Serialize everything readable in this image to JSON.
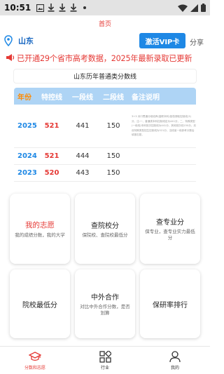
{
  "statusbar": {
    "time": "10:51"
  },
  "header": {
    "title": "首页"
  },
  "location": {
    "province": "山东",
    "vip_label": "激活VIP卡",
    "share_label": "分享"
  },
  "notice": {
    "text": "已开通29个省市高考数据，2025年最新录取已更新"
  },
  "score_table": {
    "title": "山东历年普通类分数线",
    "headers": [
      "年份",
      "特控线",
      "一段线",
      "二段线",
      "备注说明"
    ],
    "rows": [
      {
        "year": "2025",
        "special": "521",
        "tier1": "441",
        "tier2": "150",
        "note": "3+3 对口贯通分段培养(高职本科)投档录取控制线(3)分，注:一、普通类本科控制线定为441分，二、特殊类型(一段线)本科批次控制线为441分，其他批次线150分，另设特殊类型招生控制线为521分，当线省一段参考分数后填报志愿。"
      },
      {
        "year": "2024",
        "special": "521",
        "tier1": "444",
        "tier2": "150",
        "note": ""
      },
      {
        "year": "2023",
        "special": "520",
        "tier1": "443",
        "tier2": "150",
        "note": ""
      }
    ]
  },
  "cards": [
    {
      "title": "我的志愿",
      "subtitle": "我的成绩分数，我的大学"
    },
    {
      "title": "查院校分",
      "subtitle": "保院校、查院校最低分"
    },
    {
      "title": "查专业分",
      "subtitle": "保专业，查专业实力最低分"
    },
    {
      "title": "院校最低分",
      "subtitle": ""
    },
    {
      "title": "中外合作",
      "subtitle": "对比中外合作分数，是否划算"
    },
    {
      "title": "保研率排行",
      "subtitle": ""
    }
  ],
  "bottom_nav": [
    {
      "label": "分数和志愿",
      "icon": "graduation-cap-icon",
      "active": true
    },
    {
      "label": "行业",
      "icon": "apps-grid-icon",
      "active": false
    },
    {
      "label": "我的",
      "icon": "user-icon",
      "active": false
    }
  ],
  "colors": {
    "accent_red": "#e53935",
    "accent_blue": "#1e88e5",
    "table_header": "#aed4f5",
    "year_orange": "#ff8a00"
  }
}
